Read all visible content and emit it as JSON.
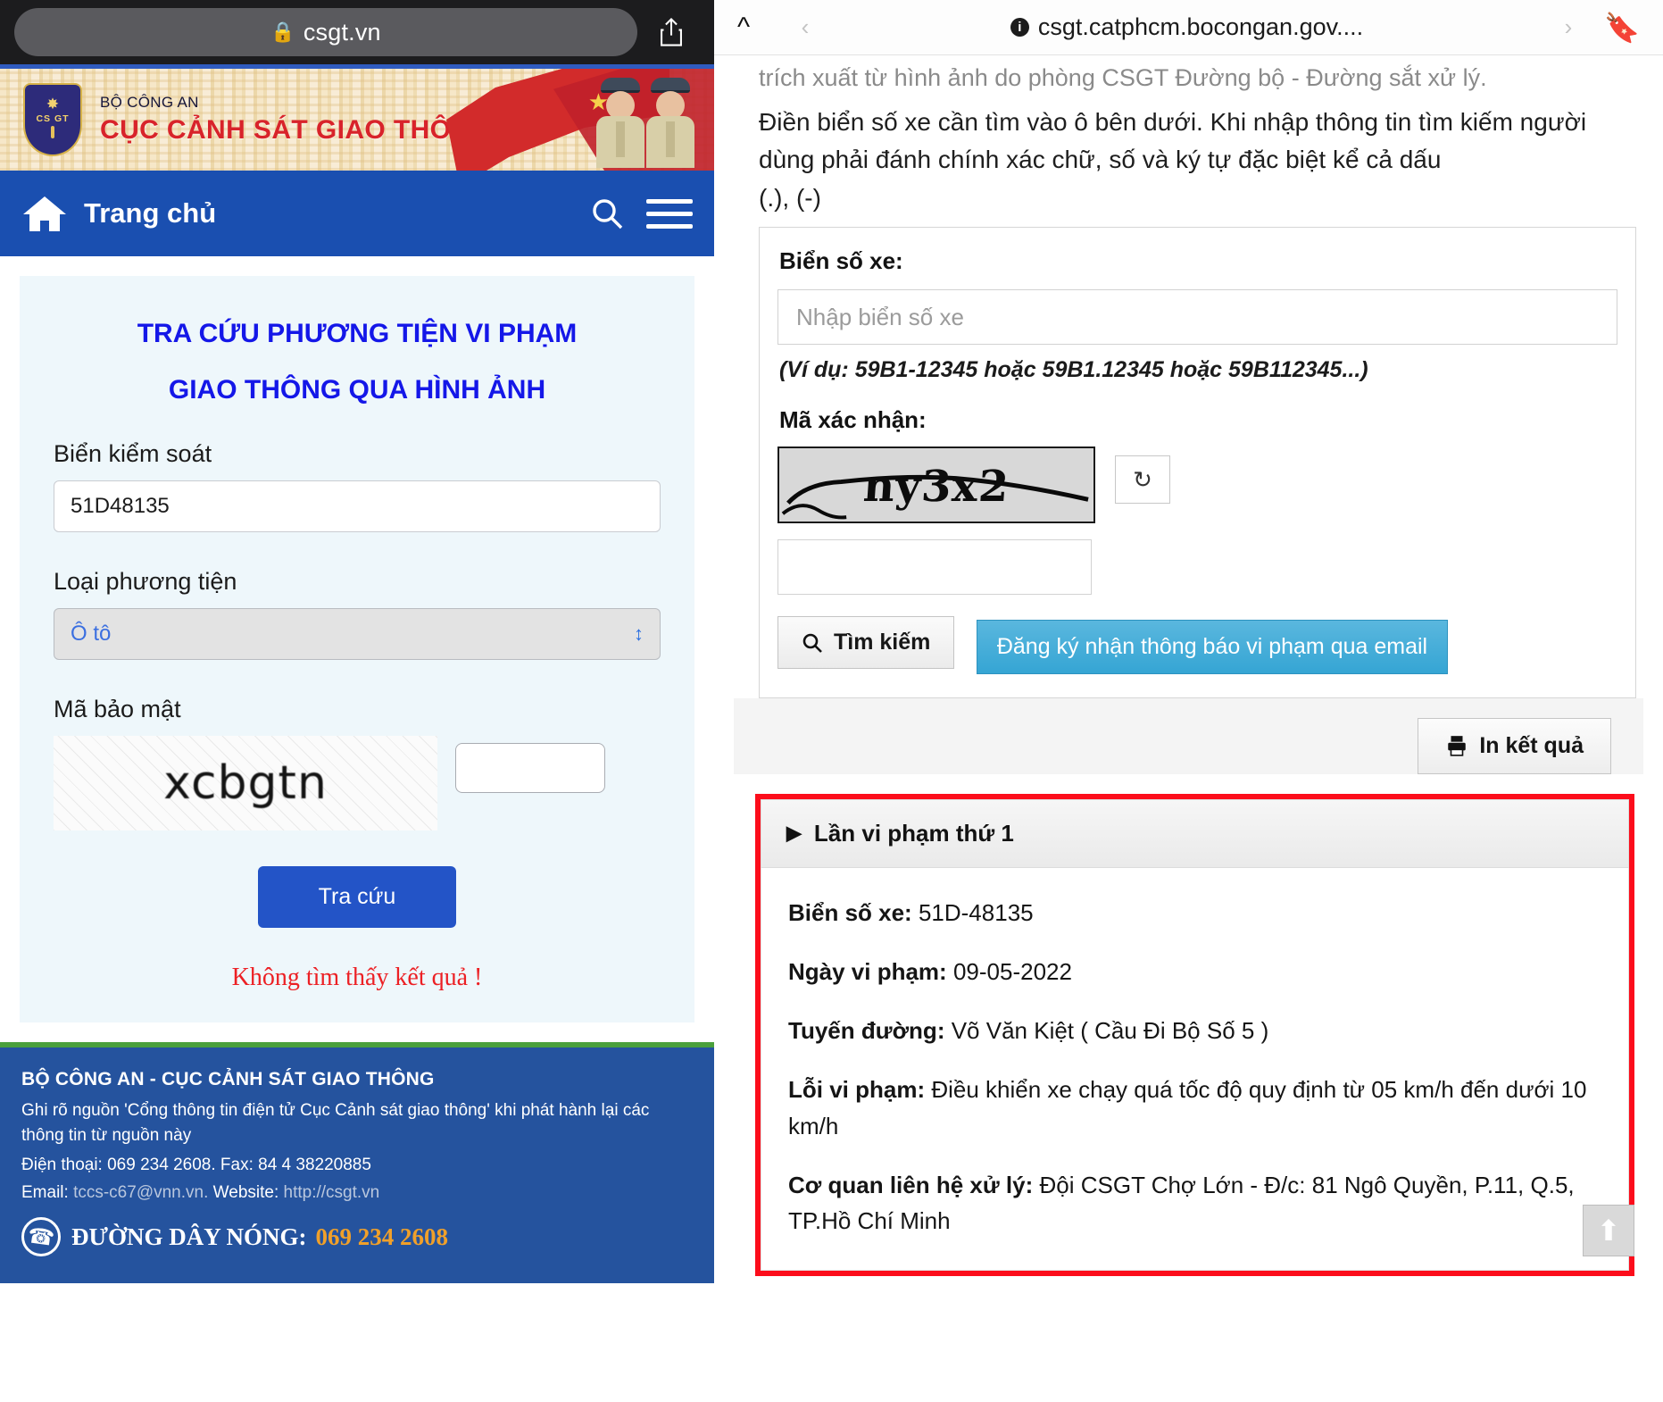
{
  "left": {
    "browser": {
      "url": "csgt.vn",
      "lock_icon": "lock-icon",
      "share_icon": "share-icon"
    },
    "banner": {
      "ministry": "BỘ CÔNG AN",
      "department": "CỤC CẢNH SÁT GIAO THÔNG",
      "emblem_text": "CS GT"
    },
    "nav": {
      "home_label": "Trang chủ",
      "home_icon": "home-icon",
      "search_icon": "search-icon",
      "menu_icon": "hamburger-menu-icon"
    },
    "form": {
      "title_line1": "TRA CỨU PHƯƠNG TIỆN VI PHẠM",
      "title_line2": "GIAO THÔNG QUA HÌNH ẢNH",
      "plate_label": "Biển kiểm soát",
      "plate_value": "51D48135",
      "vehicle_label": "Loại phương tiện",
      "vehicle_value": "Ô tô",
      "captcha_label": "Mã bảo mật",
      "captcha_text": "xcbgtn",
      "captcha_input_value": "",
      "submit_label": "Tra cứu",
      "error_message": "Không tìm thấy kết quả !"
    },
    "footer": {
      "title": "BỘ CÔNG AN - CỤC CẢNH SÁT GIAO THÔNG",
      "note": "Ghi rõ nguồn 'Cổng thông tin điện tử Cục Cảnh sát giao thông' khi phát hành lại các thông tin từ nguồn này",
      "phone_line": "Điện thoại: 069 234 2608. Fax: 84 4 38220885",
      "email_label": "Email:",
      "email_value": "tccs-c67@vnn.vn.",
      "website_label": "Website:",
      "website_value": "http://csgt.vn",
      "hotline_label": "ĐƯỜNG DÂY NÓNG:",
      "hotline_number": "069 234 2608",
      "phone_icon": "phone-icon"
    }
  },
  "right": {
    "browser": {
      "url": "csgt.catphcm.bocongan.gov....",
      "collapse_icon": "chevron-up-icon",
      "back_icon": "back-arrow-icon",
      "forward_icon": "forward-arrow-icon",
      "bookmark_icon": "bookmark-icon",
      "info_icon": "info-icon"
    },
    "intro": {
      "clipped_line": "trích xuất từ hình ảnh do phòng CSGT Đường bộ - Đường sắt xử lý.",
      "paragraph": "Điền biển số xe cần tìm vào ô bên dưới. Khi nhập thông tin tìm kiếm người dùng phải đánh chính xác chữ, số và ký tự đặc biệt kể cả dấu",
      "paragraph_tail": "(.), (-)"
    },
    "form": {
      "plate_label": "Biển số xe:",
      "plate_placeholder": "Nhập biển số xe",
      "plate_value": "",
      "plate_hint": "(Ví dụ: 59B1-12345 hoặc 59B1.12345 hoặc 59B112345...)",
      "captcha_label": "Mã xác nhận:",
      "captcha_text": "ny3x2",
      "captcha_input_value": "",
      "refresh_icon": "refresh-icon",
      "search_label": "Tìm kiếm",
      "search_icon": "search-icon",
      "email_register_label": "Đăng ký nhận thông báo vi phạm qua email"
    },
    "print_button": {
      "label": "In kết quả",
      "icon": "printer-icon"
    },
    "result": {
      "accordion_label": "Lần vi phạm thứ 1",
      "accordion_icon": "triangle-right-icon",
      "fields": [
        {
          "label": "Biển số xe:",
          "value": "51D-48135"
        },
        {
          "label": "Ngày vi phạm:",
          "value": "09-05-2022"
        },
        {
          "label": "Tuyến đường:",
          "value": "Võ Văn Kiệt ( Cầu Đi Bộ Số 5 )"
        },
        {
          "label": "Lỗi vi phạm:",
          "value": "Điều khiển xe chạy quá tốc độ quy định từ 05 km/h đến dưới 10 km/h"
        },
        {
          "label": "Cơ quan liên hệ xử lý:",
          "value": "Đội CSGT Chợ Lớn - Đ/c: 81 Ngô Quyền, P.11, Q.5, TP.Hồ Chí Minh"
        }
      ],
      "highlight_color": "#fc0d1b"
    },
    "scroll_top_icon": "scroll-to-top-icon"
  }
}
